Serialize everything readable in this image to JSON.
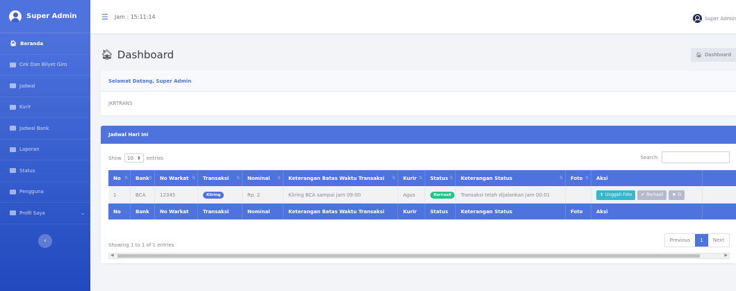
{
  "sidebar": {
    "brand": "Super Admin",
    "items": [
      {
        "label": "Beranda",
        "icon": "home-icon",
        "active": true
      },
      {
        "label": "Cek Dan Bilyet Giro",
        "icon": "card-icon"
      },
      {
        "label": "Jadwal",
        "icon": "list-icon"
      },
      {
        "label": "Kurir",
        "icon": "truck-icon"
      },
      {
        "label": "Jadwal Bank",
        "icon": "bank-icon"
      },
      {
        "label": "Laporan",
        "icon": "report-icon"
      },
      {
        "label": "Status",
        "icon": "status-icon"
      },
      {
        "label": "Pengguna",
        "icon": "users-icon"
      },
      {
        "label": "Profil Saya",
        "icon": "user-icon"
      }
    ],
    "toggle_icon": "‹"
  },
  "topbar": {
    "clock": "Jam : 15:11:14",
    "user_name": "Super Admin"
  },
  "page": {
    "title": "Dashboard",
    "breadcrumb": "Dashboard"
  },
  "welcome": {
    "heading": "Selamat Datang, Super Admin",
    "body": "JKRTRANS"
  },
  "jadwal": {
    "heading": "Jadwal Hari Ini",
    "show_label": "Show",
    "show_value": "10",
    "entries_label": "entries",
    "search_label": "Search:",
    "search_placeholder": "",
    "columns": [
      "No",
      "Bank",
      "No Warkat",
      "Transaksi",
      "Nominal",
      "Keterangan Batas Waktu Transaksi",
      "Kurir",
      "Status",
      "Keterangan Status",
      "Foto",
      "Aksi"
    ],
    "rows": [
      {
        "no": "1",
        "bank": "BCA",
        "no_warkat": "12345",
        "transaksi": "Kliring",
        "nominal": "Rp. 2",
        "batas_waktu": "Kliring BCA sampai jam 09:00",
        "kurir": "Agus",
        "status": "Berhasil",
        "keterangan_status": "Transaksi telah dijalankan jam 00:01",
        "foto": "",
        "actions": [
          "Unggah Foto",
          "Berhasil",
          "D"
        ]
      }
    ],
    "info": "Showing 1 to 1 of 1 entries",
    "pager": {
      "previous": "Previous",
      "current": "1",
      "next": "Next"
    }
  },
  "colors": {
    "primary": "#4e73df",
    "success": "#1cc88a",
    "info": "#36b9cc",
    "secondary": "#b7b9cc"
  }
}
